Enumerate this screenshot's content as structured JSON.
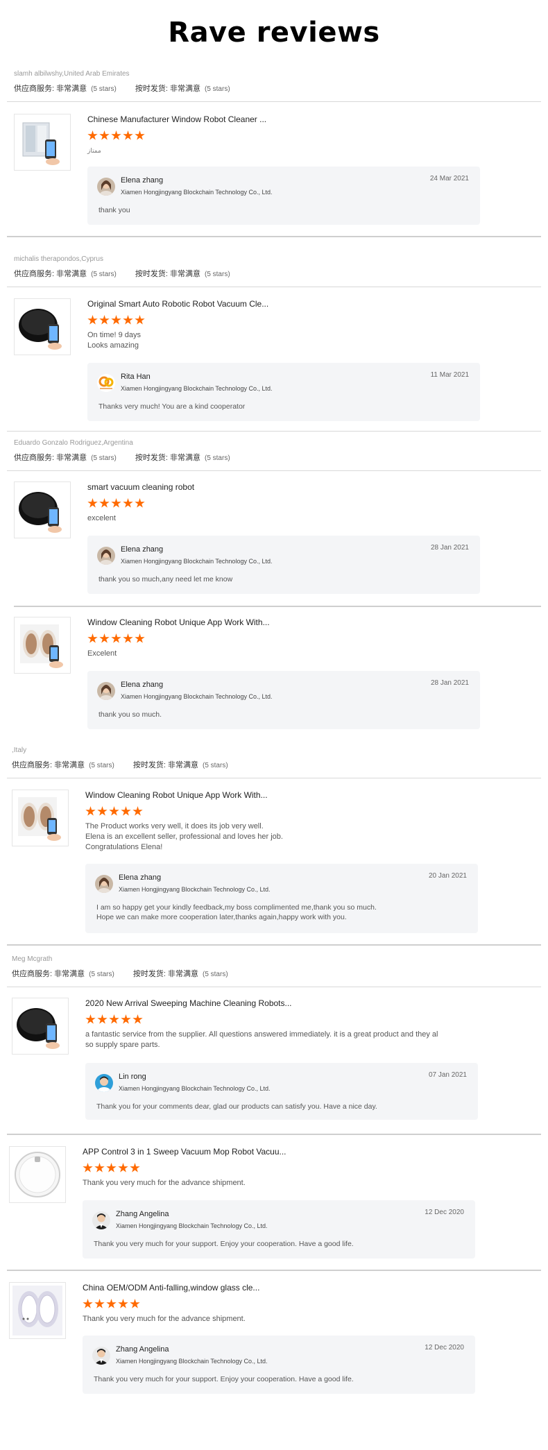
{
  "page": {
    "title": "Rave reviews"
  },
  "rating_labels": {
    "supplier_service": "供应商服务:",
    "on_time_shipment": "按时发货:",
    "very_satisfied": "非常满意",
    "stars_count": "(5 stars)"
  },
  "buyers": [
    {
      "name": "slamh albilwshy,United Arab Emirates"
    },
    {
      "name": "michalis therapondos,Cyprus"
    },
    {
      "name": "Eduardo Gonzalo Rodriguez,Argentina"
    },
    {
      "name": ",Italy"
    },
    {
      "name": "Meg Mcgrath"
    }
  ],
  "reviews": [
    {
      "product_title": "Chinese Manufacturer Window Robot Cleaner ...",
      "rating": 5,
      "comment": "ممتاز",
      "thumb": "window-robot-app-icon",
      "reply": {
        "name": "Elena zhang",
        "company": "Xiamen Hongjingyang Blockchain Technology Co., Ltd.",
        "date": "24 Mar 2021",
        "text": "thank you",
        "avatar": "woman-avatar-icon"
      }
    },
    {
      "product_title": "Original Smart Auto Robotic Robot Vacuum Cle...",
      "rating": 5,
      "comment": "On time! 9 days\nLooks amazing",
      "thumb": "black-robot-vacuum-icon",
      "reply": {
        "name": "Rita Han",
        "company": "Xiamen Hongjingyang Blockchain Technology Co., Ltd.",
        "date": "11 Mar 2021",
        "text": "Thanks very much! You are a kind cooperator",
        "avatar": "company-logo-icon"
      }
    },
    {
      "product_title": "smart vacuum cleaning robot",
      "rating": 5,
      "comment": "excelent",
      "thumb": "black-robot-vacuum-icon",
      "reply": {
        "name": "Elena zhang",
        "company": "Xiamen Hongjingyang Blockchain Technology Co., Ltd.",
        "date": "28 Jan 2021",
        "text": "thank you so much,any need let me know",
        "avatar": "woman-avatar-icon"
      }
    },
    {
      "product_title": "Window Cleaning Robot Unique App Work With...",
      "rating": 5,
      "comment": "Excelent",
      "thumb": "window-robot-gold-icon",
      "reply": {
        "name": "Elena zhang",
        "company": "Xiamen Hongjingyang Blockchain Technology Co., Ltd.",
        "date": "28 Jan 2021",
        "text": "thank you so much.",
        "avatar": "woman-avatar-icon"
      }
    },
    {
      "product_title": "Window Cleaning Robot Unique App Work With...",
      "rating": 5,
      "comment": "The Product works very well, it does its job very well.\nElena is an excellent seller, professional and loves her job.\nCongratulations Elena!",
      "thumb": "window-robot-gold-icon",
      "reply": {
        "name": "Elena zhang",
        "company": "Xiamen Hongjingyang Blockchain Technology Co., Ltd.",
        "date": "20 Jan 2021",
        "text": "I am so happy get your kindly feedback,my boss complimented me,thank you so much.\nHope we can make more cooperation later,thanks again,happy work with you.",
        "avatar": "woman-avatar-icon"
      }
    },
    {
      "product_title": "2020 New Arrival Sweeping Machine Cleaning Robots...",
      "rating": 5,
      "comment": "a fantastic service from the supplier.  All questions answered immediately.  it is a great product and they al\nso supply spare parts.",
      "thumb": "black-robot-vacuum-icon",
      "reply": {
        "name": "Lin rong",
        "company": "Xiamen Hongjingyang Blockchain Technology Co., Ltd.",
        "date": "07 Jan 2021",
        "text": "Thank you for your comments dear, glad our products can satisfy you.   Have a nice day.",
        "avatar": "man-avatar-icon"
      }
    },
    {
      "product_title": "APP Control 3 in 1 Sweep Vacuum Mop Robot Vacuu...",
      "rating": 5,
      "comment": "Thank you very much for the advance shipment.",
      "thumb": "white-robot-vacuum-icon",
      "reply": {
        "name": "Zhang Angelina",
        "company": "Xiamen Hongjingyang Blockchain Technology Co., Ltd.",
        "date": "12 Dec 2020",
        "text": "Thank you very much for your support. Enjoy your cooperation. Have a good life.",
        "avatar": "suit-avatar-icon"
      }
    },
    {
      "product_title": "China OEM/ODM Anti-falling,window glass cle...",
      "rating": 5,
      "comment": "Thank you very much for the advance shipment.",
      "thumb": "window-robot-white-icon",
      "reply": {
        "name": "Zhang Angelina",
        "company": "Xiamen Hongjingyang Blockchain Technology Co., Ltd.",
        "date": "12 Dec 2020",
        "text": "Thank you very much for your support. Enjoy your cooperation. Have a good life.",
        "avatar": "suit-avatar-icon"
      }
    }
  ]
}
